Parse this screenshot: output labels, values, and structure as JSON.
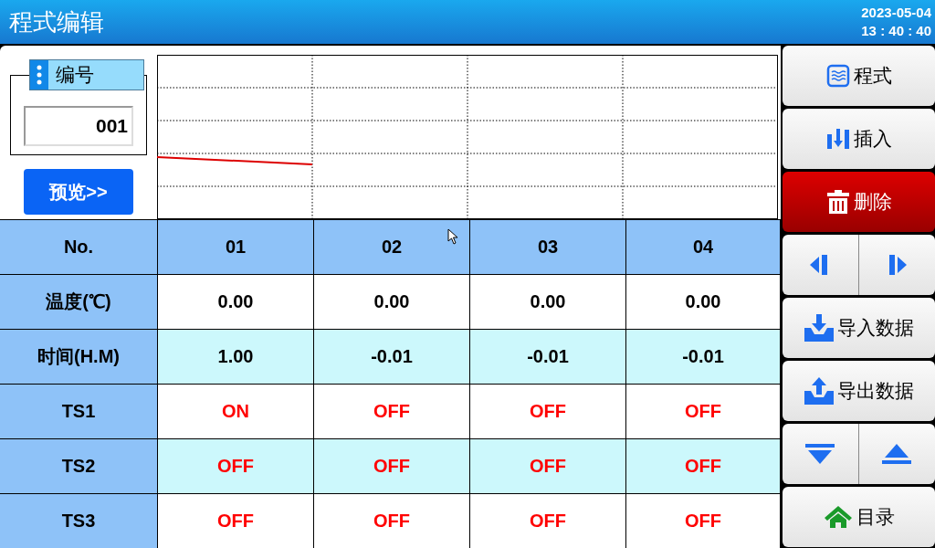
{
  "header": {
    "title": "程式编辑",
    "date": "2023-05-04",
    "time": "13 : 40 : 40"
  },
  "number_group": {
    "label": "编号",
    "value": "001"
  },
  "preview_button": "预览>>",
  "table": {
    "columns": [
      "No.",
      "01",
      "02",
      "03",
      "04"
    ],
    "rows": [
      {
        "kind": "value",
        "cells": [
          "温度(℃)",
          "0.00",
          "0.00",
          "0.00",
          "0.00"
        ]
      },
      {
        "kind": "value",
        "cells": [
          "时间(H.M)",
          "1.00",
          "-0.01",
          "-0.01",
          "-0.01"
        ]
      },
      {
        "kind": "switch",
        "cells": [
          "TS1",
          "ON",
          "OFF",
          "OFF",
          "OFF"
        ]
      },
      {
        "kind": "switch",
        "cells": [
          "TS2",
          "OFF",
          "OFF",
          "OFF",
          "OFF"
        ]
      },
      {
        "kind": "switch",
        "cells": [
          "TS3",
          "OFF",
          "OFF",
          "OFF",
          "OFF"
        ]
      }
    ]
  },
  "side_buttons": [
    {
      "kind": "normal",
      "label": "程式"
    },
    {
      "kind": "normal",
      "label": "插入"
    },
    {
      "kind": "danger",
      "label": "删除"
    },
    {
      "kind": "pair"
    },
    {
      "kind": "normal",
      "label": "导入数据"
    },
    {
      "kind": "normal",
      "label": "导出数据"
    },
    {
      "kind": "pair"
    },
    {
      "kind": "normal",
      "label": "目录"
    }
  ]
}
